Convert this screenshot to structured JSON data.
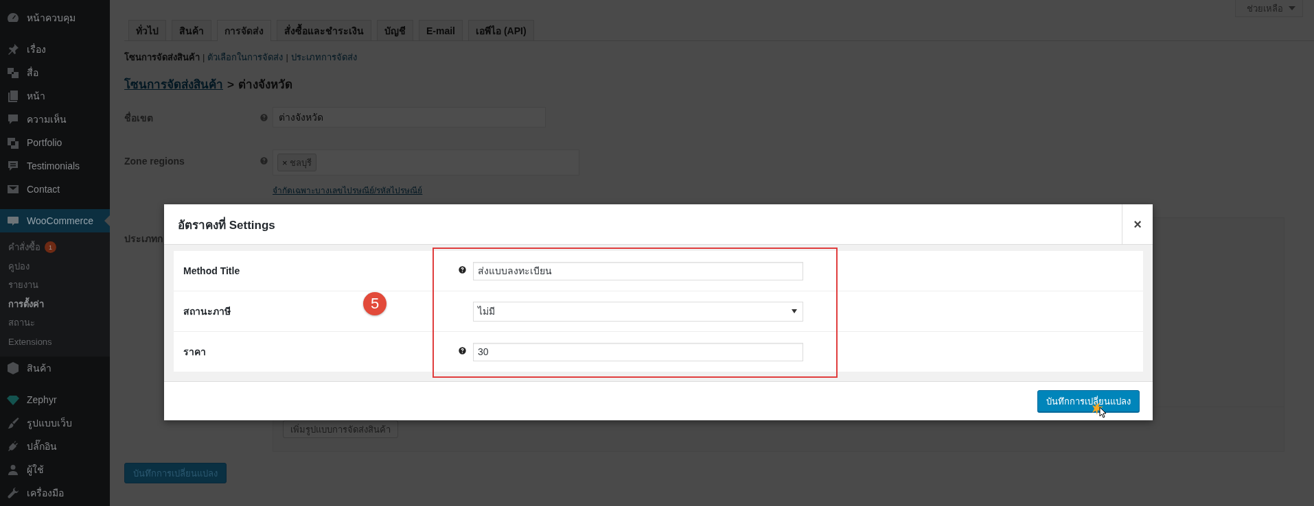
{
  "help_button": {
    "label": "ช่วยเหลือ"
  },
  "sidebar": {
    "groups": [
      [
        {
          "label": "หน้าควบคุม",
          "selected": false
        }
      ],
      [
        {
          "label": "เรื่อง",
          "selected": false
        },
        {
          "label": "สื่อ",
          "selected": false
        },
        {
          "label": "หน้า",
          "selected": false
        },
        {
          "label": "ความเห็น",
          "selected": false
        },
        {
          "label": "Portfolio",
          "selected": false
        },
        {
          "label": "Testimonials",
          "selected": false
        },
        {
          "label": "Contact",
          "selected": false
        }
      ],
      [
        {
          "label": "WooCommerce",
          "selected": true,
          "children": [
            {
              "label": "คำสั่งซื้อ",
              "badge": "1",
              "selected": false
            },
            {
              "label": "คูปอง",
              "selected": false
            },
            {
              "label": "รายงาน",
              "selected": false
            },
            {
              "label": "การตั้งค่า",
              "selected": true
            },
            {
              "label": "สถานะ",
              "selected": false
            },
            {
              "label": "Extensions",
              "selected": false
            }
          ]
        },
        {
          "label": "สินค้า",
          "selected": false
        }
      ],
      [
        {
          "label": "Zephyr",
          "selected": false
        },
        {
          "label": "รูปแบบเว็บ",
          "selected": false
        },
        {
          "label": "ปลั๊กอิน",
          "selected": false
        },
        {
          "label": "ผู้ใช้",
          "selected": false
        },
        {
          "label": "เครื่องมือ",
          "selected": false
        }
      ]
    ]
  },
  "tabs": [
    {
      "label": "ทั่วไป",
      "selected": false
    },
    {
      "label": "สินค้า",
      "selected": false
    },
    {
      "label": "การจัดส่ง",
      "selected": true
    },
    {
      "label": "สั่งซื้อและชำระเงิน",
      "selected": false
    },
    {
      "label": "บัญชี",
      "selected": false
    },
    {
      "label": "E-mail",
      "selected": false
    },
    {
      "label": "เอพีไอ (API)",
      "selected": false
    }
  ],
  "subnav": {
    "separator": "|",
    "items": [
      {
        "label": "โซนการจัดส่งสินค้า",
        "selected": true
      },
      {
        "label": "ตัวเลือกในการจัดส่ง",
        "selected": false
      },
      {
        "label": "ประเภทการจัดส่ง",
        "selected": false
      }
    ]
  },
  "breadcrumb": {
    "parent": "โซนการจัดส่งสินค้า",
    "separator": ">",
    "current": "ต่างจังหวัด"
  },
  "zone_form": {
    "zone_name": {
      "label": "ชื่อเขต",
      "value": "ต่างจังหวัด",
      "help": true
    },
    "zone_regions": {
      "label": "Zone regions",
      "help": true,
      "tags": [
        {
          "label": "ชลบุรี",
          "remove": "×"
        }
      ],
      "link": "จำกัดเฉพาะบางเลขไปรษณีย์/รหัสไปรษณีย์"
    },
    "shipping_methods": {
      "label": "ประเภทก",
      "add_button": "เพิ่มรูปแบบการจัดส่งสินค้า"
    }
  },
  "save_button": {
    "label": "บันทึกการเปลี่ยนแปลง"
  },
  "modal": {
    "title": "อัตราคงที่ Settings",
    "close": "×",
    "step_badge": "5",
    "fields": [
      {
        "label": "Method Title",
        "kind": "text",
        "value": "ส่งแบบลงทะเบียน",
        "help": true
      },
      {
        "label": "สถานะภาษี",
        "kind": "select",
        "value": "ไม่มี",
        "help": false
      },
      {
        "label": "ราคา",
        "kind": "text",
        "value": "30",
        "help": true
      }
    ],
    "save_button": "บันทึกการเปลี่ยนแปลง"
  }
}
